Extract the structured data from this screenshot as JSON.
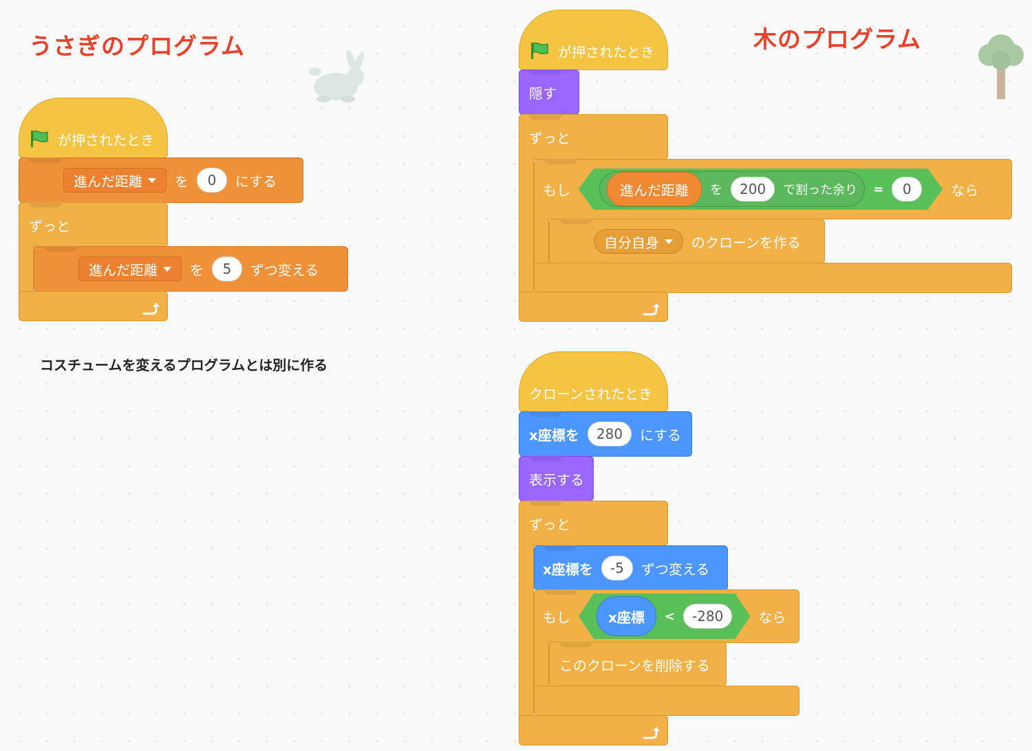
{
  "headings": {
    "rabbit": "うさぎのプログラム",
    "tree": "木のプログラム"
  },
  "note": "コスチュームを変えるプログラムとは別に作る",
  "icons": {
    "flag": "green-flag-icon",
    "loop_arrow": "loop-arrow-icon",
    "dropdown": "dropdown-caret-icon"
  },
  "colors": {
    "heading": "#e5432c",
    "events": "#f5c443",
    "control": "#f2b146",
    "variables": "#ef9138",
    "looks": "#9966ff",
    "motion": "#4c97ff",
    "operators": "#59c059"
  },
  "rabbit_script": {
    "hat": "が押されたとき",
    "set_var": {
      "var": "進んだ距離",
      "to": "を",
      "value": "0",
      "suffix": "にする"
    },
    "forever": "ずっと",
    "change_var": {
      "var": "進んだ距離",
      "by": "を",
      "value": "5",
      "suffix": "ずつ変える"
    }
  },
  "tree_script": {
    "hat": "が押されたとき",
    "hide": "隠す",
    "forever": "ずっと",
    "if": {
      "label": "もし",
      "var": "進んだ距離",
      "wo": "を",
      "divisor": "200",
      "mod": "で割った余り",
      "eq": "=",
      "rhs": "0",
      "then": "なら"
    },
    "clone": {
      "target": "自分自身",
      "suffix": "のクローンを作る"
    }
  },
  "clone_script": {
    "hat": "クローンされたとき",
    "set_x": {
      "label": "x座標を",
      "value": "280",
      "suffix": "にする"
    },
    "show": "表示する",
    "forever": "ずっと",
    "change_x": {
      "label": "x座標を",
      "value": "-5",
      "suffix": "ずつ変える"
    },
    "if": {
      "label": "もし",
      "reporter": "x座標",
      "lt": "<",
      "rhs": "-280",
      "then": "なら"
    },
    "delete": "このクローンを削除する"
  }
}
